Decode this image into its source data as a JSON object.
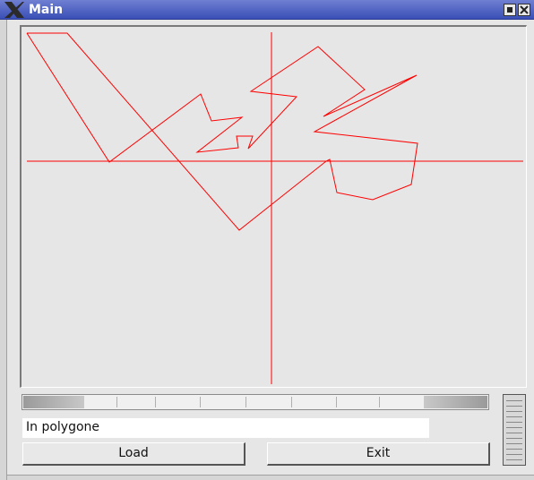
{
  "window": {
    "title": "Main",
    "title_icon": "x-logo-icon",
    "controls": [
      {
        "name": "minimize-button",
        "icon": "minimize-icon"
      },
      {
        "name": "close-button",
        "icon": "close-icon"
      }
    ]
  },
  "status": {
    "text": "In polygone"
  },
  "buttons": {
    "load_label": "Load",
    "exit_label": "Exit"
  },
  "colors": {
    "titlebar": "#3a4fb6",
    "drawing": "#ff0000",
    "canvas": "#e6e6e6"
  }
}
